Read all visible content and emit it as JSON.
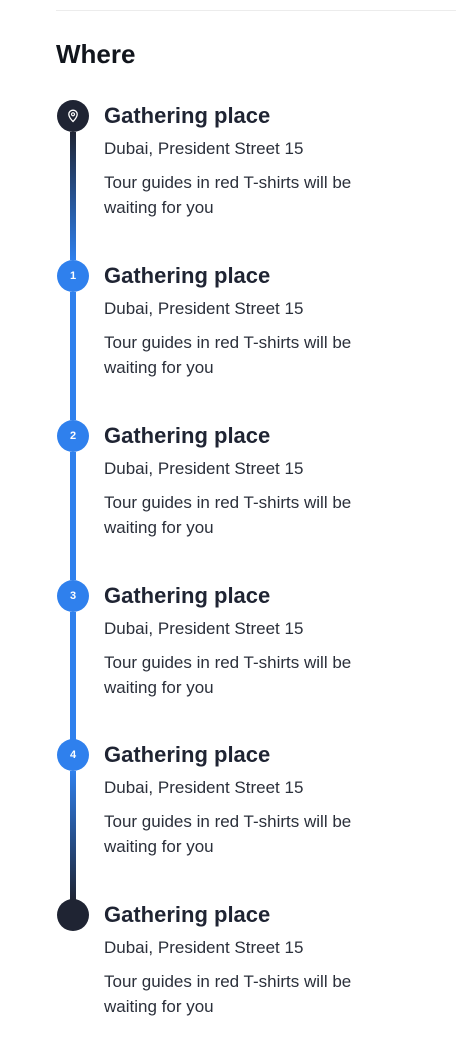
{
  "section": {
    "title": "Where"
  },
  "stops": [
    {
      "marker": "location-pin",
      "title": "Gathering place",
      "address": "Dubai, President Street 15",
      "note": "Tour guides in red T-shirts will be waiting for you"
    },
    {
      "marker": "1",
      "title": "Gathering place",
      "address": "Dubai, President Street 15",
      "note": "Tour guides in red T-shirts will be waiting for you"
    },
    {
      "marker": "2",
      "title": "Gathering place",
      "address": "Dubai, President Street 15",
      "note": "Tour guides in red T-shirts will be waiting for you"
    },
    {
      "marker": "3",
      "title": "Gathering place",
      "address": "Dubai, President Street 15",
      "note": "Tour guides in red T-shirts will be waiting for you"
    },
    {
      "marker": "4",
      "title": "Gathering place",
      "address": "Dubai, President Street 15",
      "note": "Tour guides in red T-shirts will be waiting for you"
    },
    {
      "marker": "end-dot",
      "title": "Gathering place",
      "address": "Dubai, President Street 15",
      "note": "Tour guides in red T-shirts will be waiting for you"
    }
  ],
  "colors": {
    "accent": "#2f80ed",
    "dark": "#1f2433"
  }
}
